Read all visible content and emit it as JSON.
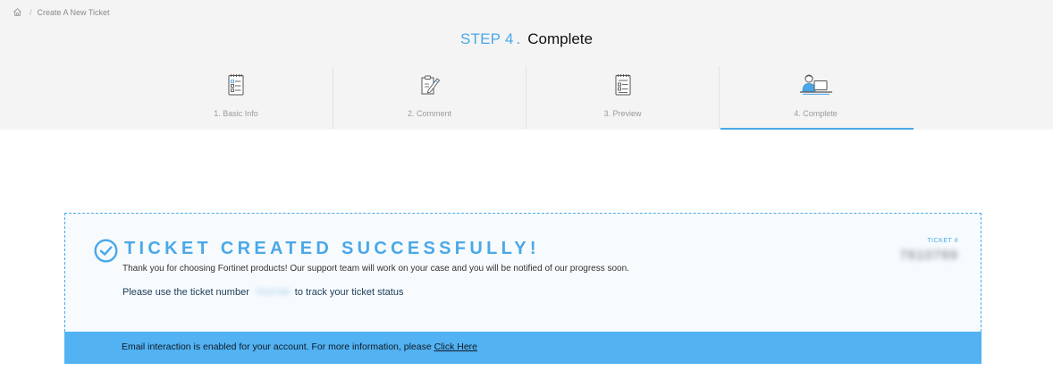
{
  "breadcrumb": {
    "home_icon": "home-icon",
    "separator": "/",
    "current": "Create A New Ticket"
  },
  "header": {
    "step_number": "STEP 4",
    "step_dot": ".",
    "step_name": "Complete"
  },
  "steps": [
    {
      "label": "1. Basic Info",
      "icon": "checklist-icon",
      "active": false
    },
    {
      "label": "2. Comment",
      "icon": "clipboard-pen-icon",
      "active": false
    },
    {
      "label": "3. Preview",
      "icon": "document-preview-icon",
      "active": false
    },
    {
      "label": "4. Complete",
      "icon": "person-laptop-icon",
      "active": true
    }
  ],
  "success": {
    "icon": "check-circle-icon",
    "title": "TICKET CREATED SUCCESSFULLY!",
    "message": "Thank you for choosing Fortinet products! Our support team will work on your case and you will be notified of our progress soon.",
    "track_prefix": "Please use the ticket number",
    "ticket_number": "7610769",
    "track_suffix": "to track your ticket status",
    "ticket_label": "TICKET #"
  },
  "email_banner": {
    "text": "Email interaction is enabled for your account. For more information, please",
    "link_label": "Click Here"
  },
  "colors": {
    "accent": "#4aa8e8",
    "banner": "#52b2f2",
    "header_bg": "#f4f4f4"
  }
}
